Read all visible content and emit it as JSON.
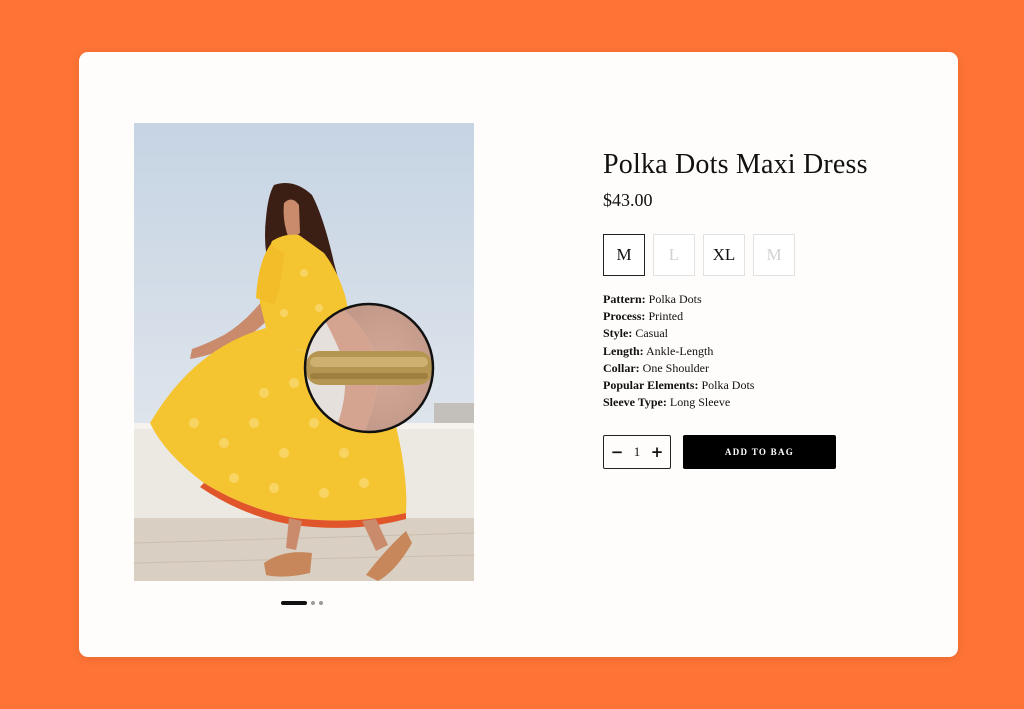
{
  "product": {
    "title": "Polka Dots Maxi Dress",
    "price": "$43.00",
    "image_icon": "product-photo",
    "carousel": {
      "count": 3,
      "active_index": 0
    }
  },
  "sizes": [
    {
      "label": "M",
      "state": "selected"
    },
    {
      "label": "L",
      "state": "disabled"
    },
    {
      "label": "XL",
      "state": "available"
    },
    {
      "label": "M",
      "state": "disabled"
    }
  ],
  "specs": [
    {
      "key": "Pattern:",
      "value": "Polka Dots"
    },
    {
      "key": "Process:",
      "value": "Printed"
    },
    {
      "key": "Style:",
      "value": "Casual"
    },
    {
      "key": "Length:",
      "value": "Ankle-Length"
    },
    {
      "key": "Collar:",
      "value": "One Shoulder"
    },
    {
      "key": "Popular Elements:",
      "value": "Polka Dots"
    },
    {
      "key": "Sleeve Type:",
      "value": "Long Sleeve"
    }
  ],
  "quantity": {
    "minus_icon": "minus-icon",
    "value": "1",
    "plus_icon": "plus-icon"
  },
  "add_to_bag_label": "ADD TO BAG",
  "colors": {
    "background": "#FF7436",
    "card": "#FEFDFB",
    "button": "#000000",
    "dress": "#F5C431"
  }
}
